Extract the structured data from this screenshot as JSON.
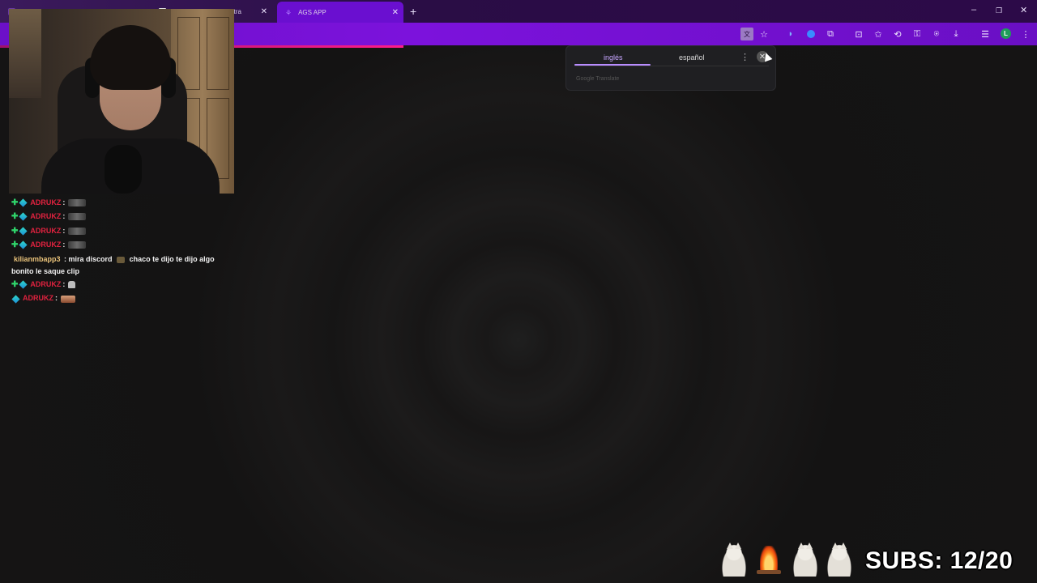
{
  "browser": {
    "tabs": [
      {
        "label": "",
        "active": false
      },
      {
        "label": "Ultra",
        "active": false
      },
      {
        "label": "AGS APP",
        "active": true
      }
    ],
    "new_tab_symbol": "+",
    "window_controls": {
      "minimize": "–",
      "restore": "❐",
      "close": "✕"
    },
    "toolbar_icons": [
      "translate-icon",
      "star-icon",
      "extension-icon",
      "extensions-icon",
      "screenshot-icon",
      "favorites-icon",
      "history-icon",
      "passwords-icon",
      "pin-icon",
      "download-icon",
      "reading-list-icon",
      "profile-avatar",
      "more-menu-icon"
    ],
    "profile_initial": "L",
    "more_menu_symbol": "⋮"
  },
  "translate_popup": {
    "source_lang": "inglés",
    "target_lang": "español",
    "menu_symbol": "⋮",
    "close_symbol": "✕",
    "footer": "Google Translate"
  },
  "chat": {
    "messages": [
      {
        "user": "ADRUKZ",
        "text": ":",
        "emote": "emote-pixel",
        "badges": [
          "plus",
          "gem"
        ],
        "user_color": "#e0223f"
      },
      {
        "user": "ADRUKZ",
        "text": ":",
        "emote": "emote-pixel",
        "badges": [
          "plus",
          "gem"
        ],
        "user_color": "#e0223f"
      },
      {
        "user": "ADRUKZ",
        "text": ":",
        "emote": "emote-pixel",
        "badges": [
          "plus",
          "gem"
        ],
        "user_color": "#e0223f"
      },
      {
        "user": "ADRUKZ",
        "text": ":",
        "emote": "emote-pixel",
        "badges": [
          "plus",
          "gem"
        ],
        "user_color": "#e0223f"
      },
      {
        "user": "kilianmbapp3",
        "text_before": ": mira discord",
        "text_after": "chaco te dijo te dijo algo bonito le saque clip",
        "user_color": "#e8c27a"
      },
      {
        "user": "ADRUKZ",
        "text": ":",
        "emote": "emote-small",
        "badges": [
          "plus",
          "gem"
        ],
        "user_color": "#e0223f"
      },
      {
        "user": "ADRUKZ",
        "text": ":",
        "emote": "emote-cake",
        "badges": [
          "gem"
        ],
        "user_color": "#e0223f"
      }
    ]
  },
  "subs": {
    "label": "SUBS: 12/20"
  },
  "colors": {
    "tabbar": "#2a0d45",
    "toolbar": "#7a0fd8",
    "active_tab": "#6a0fd0",
    "progress": "#ff1c8a",
    "background": "#171616"
  }
}
